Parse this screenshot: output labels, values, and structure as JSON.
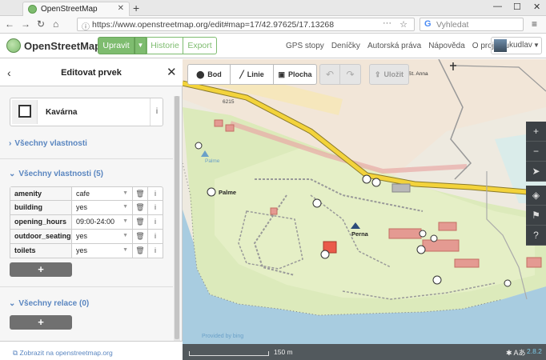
{
  "browser": {
    "tab_title": "OpenStreetMap",
    "url": "https://www.openstreetmap.org/edit#map=17/42.97625/17.13268",
    "search_placeholder": "Vyhledat"
  },
  "header": {
    "brand": "OpenStreetMap",
    "edit_button": "Upravit",
    "history_button": "Historie",
    "export_button": "Export",
    "links": [
      "GPS stopy",
      "Deníčky",
      "Autorská práva",
      "Nápověda",
      "O projektu"
    ],
    "username": "kudlav"
  },
  "sidebar": {
    "title": "Editovat prvek",
    "preset_label": "Kavárna",
    "all_fields_label": "Všechny vlastnosti",
    "tags_section_label": "Všechny vlastnosti (5)",
    "tags": [
      {
        "key": "amenity",
        "value": "cafe"
      },
      {
        "key": "building",
        "value": "yes"
      },
      {
        "key": "opening_hours",
        "value": "09:00-24:00"
      },
      {
        "key": "outdoor_seating",
        "value": "yes"
      },
      {
        "key": "toilets",
        "value": "yes"
      }
    ],
    "add_tag_symbol": "+",
    "relations_label": "Všechny relace (0)",
    "add_relation_symbol": "+",
    "footer_link": "Zobrazit na openstreetmap.org"
  },
  "map": {
    "toolbar": {
      "point": "Bod",
      "line": "Linie",
      "area": "Plocha",
      "save": "Uložit"
    },
    "labels": {
      "road_ref": "6215",
      "church": "St. Anna",
      "palme_poi": "Palme",
      "palme_poi_small": "Palme",
      "perna": "Perna"
    },
    "scale": "150 m",
    "attribution": "Provided by bing",
    "version": "2.8.2"
  },
  "colors": {
    "accent": "#7ebc6f",
    "link": "#5a86c0",
    "water": "#a8cce0",
    "road": "#f3d33b"
  }
}
